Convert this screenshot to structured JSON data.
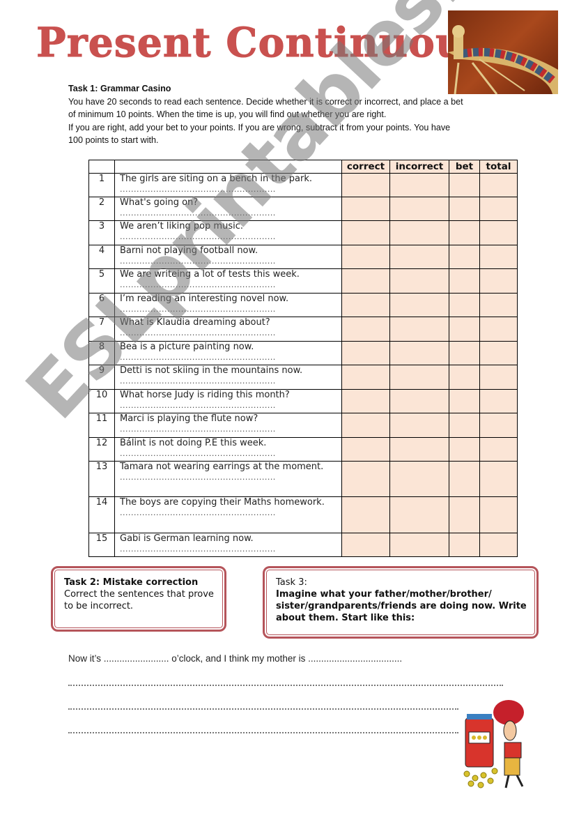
{
  "title": "Present Continuous",
  "watermark": "ESLprintables.com",
  "images": {
    "roulette": "roulette-wheel-image",
    "gambler": "slot-machine-cartoon-image"
  },
  "task1": {
    "heading": "Task 1: Grammar Casino",
    "instructions": [
      "You have 20 seconds to read each sentence. Decide whether it is correct or incorrect, and place a bet",
      "of minimum 10 points.  When the time is up, you will find out whether you are right.",
      "If you are right, add your bet to your points. If you are wrong, subtract it from your points. You have",
      "100 points to start with."
    ],
    "columns": [
      "",
      "",
      "correct",
      "incorrect",
      "bet",
      "total"
    ],
    "dots": "........................................................",
    "rows": [
      {
        "n": "1",
        "s": "The girls are siting on a bench in the park."
      },
      {
        "n": "2",
        "s": "What's going on?"
      },
      {
        "n": "3",
        "s": "We aren’t liking pop music."
      },
      {
        "n": "4",
        "s": "Barni not playing football now."
      },
      {
        "n": "5",
        "s": "We are writeing a lot of tests this week."
      },
      {
        "n": "6",
        "s": "I’m reading an interesting novel now."
      },
      {
        "n": "7",
        "s": "What is Klaudia dreaming about?"
      },
      {
        "n": "8",
        "s": "Bea is a picture painting now."
      },
      {
        "n": "9",
        "s": "Detti is not skiing in the mountains now."
      },
      {
        "n": "10",
        "s": "What horse Judy is riding this month?"
      },
      {
        "n": "11",
        "s": "Marci is playing the flute now?"
      },
      {
        "n": "12",
        "s": "Bálint is not doing P.E this week."
      },
      {
        "n": "13",
        "s": "Tamara not wearing earrings at the moment."
      },
      {
        "n": "14",
        "s": "The boys are copying their Maths homework."
      },
      {
        "n": "15",
        "s": "Gabi is German learning now."
      }
    ]
  },
  "task2": {
    "heading": "Task 2: Mistake correction",
    "body": "Correct the sentences that prove to be incorrect."
  },
  "task3": {
    "heading": "Task 3:",
    "body": "Imagine what your father/mother/brother/ sister/grandparents/friends are doing now. Write about them. Start like this:"
  },
  "writing": {
    "starter": "Now it’s ......................... o’clock, and I think my mother is ...................................."
  },
  "colors": {
    "title": "#c9514f",
    "cell_fill": "#fbe5d6",
    "box_border": "#b5545a"
  }
}
